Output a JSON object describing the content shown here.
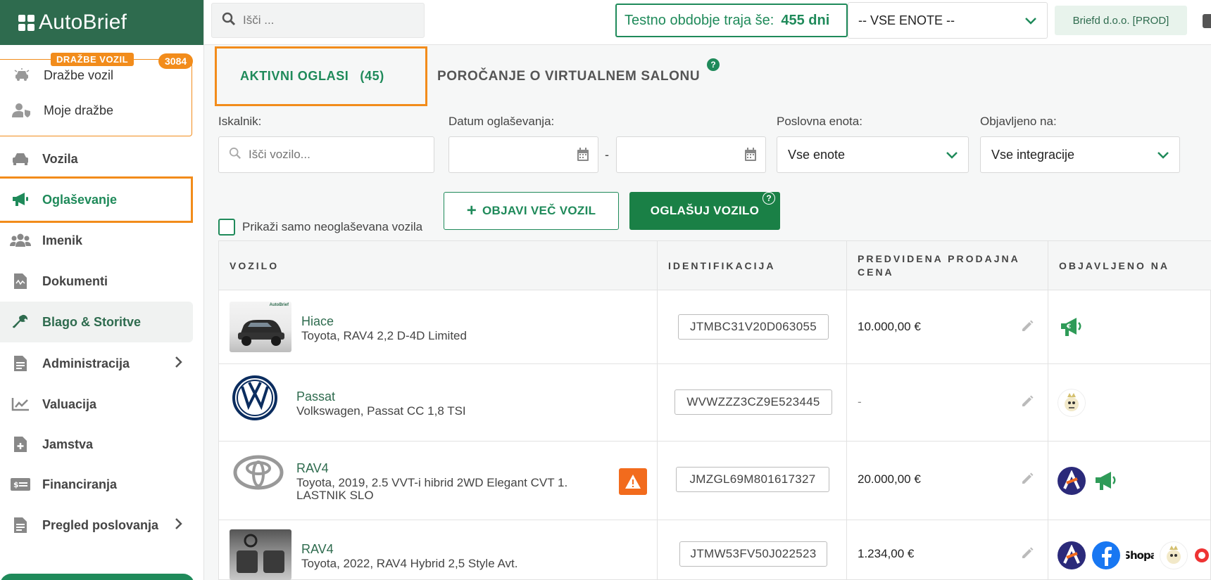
{
  "app": {
    "name": "AutoBrief"
  },
  "topbar": {
    "search_placeholder": "Išči ...",
    "trial_text": "Testno obdobje traja še:",
    "trial_days": "455 dni",
    "unit_select": "-- VSE ENOTE --",
    "company": "Briefd d.o.o. [PROD]"
  },
  "sidebar": {
    "auction": {
      "label": "DRAŽBE VOZIL",
      "count": "3084",
      "items": [
        "Dražbe vozil",
        "Moje dražbe"
      ]
    },
    "items": [
      {
        "label": "Vozila"
      },
      {
        "label": "Oglaševanje"
      },
      {
        "label": "Imenik"
      },
      {
        "label": "Dokumenti"
      },
      {
        "label": "Blago & Storitve"
      },
      {
        "label": "Administracija"
      },
      {
        "label": "Valuacija"
      },
      {
        "label": "Jamstva"
      },
      {
        "label": "Financiranja"
      },
      {
        "label": "Pregled poslovanja"
      }
    ]
  },
  "tabs": {
    "active_label": "AKTIVNI OGLASI",
    "active_count": "(45)",
    "other_label": "POROČANJE O VIRTUALNEM SALONU"
  },
  "filters": {
    "search_label": "Iskalnik:",
    "search_placeholder": "Išči vozilo...",
    "date_label": "Datum oglaševanja:",
    "unit_label": "Poslovna enota:",
    "unit_value": "Vse enote",
    "published_label": "Objavljeno na:",
    "published_value": "Vse integracije",
    "checkbox_label": "Prikaži samo neoglaševana vozila",
    "btn_publish_multi": "OBJAVI VEČ VOZIL",
    "btn_advertise": "OGLAŠUJ VOZILO"
  },
  "table": {
    "headers": [
      "VOZILO",
      "IDENTIFIKACIJA",
      "PREDVIDENA PRODAJNA CENA",
      "OBJAVLJENO NA"
    ],
    "rows": [
      {
        "title": "Hiace",
        "subtitle": "Toyota, RAV4 2,2 D-4D Limited",
        "vin": "JTMBC31V20D063055",
        "price": "10.000,00 €",
        "thumb_text": "AutoBrief"
      },
      {
        "title": "Passat",
        "subtitle": "Volkswagen, Passat CC 1,8 TSI",
        "vin": "WVWZZZ3CZ9E523445",
        "price": "-"
      },
      {
        "title": "RAV4",
        "subtitle": "Toyota, 2019, 2.5 VVT-i hibrid 2WD Elegant CVT 1. LASTNIK SLO",
        "vin": "JMZGL69M801617327",
        "price": "20.000,00 €"
      },
      {
        "title": "RAV4",
        "subtitle": "Toyota, 2022, RAV4 Hybrid 2,5 Style Avt.",
        "vin": "JTMW53FV50J022523",
        "price": "1.234,00 €",
        "logo_text": "Shopa"
      }
    ]
  },
  "colors": {
    "brand": "#2e6b4e",
    "accent": "#1f8a5a",
    "highlight": "#f28c1b",
    "warning": "#f26b1d"
  }
}
